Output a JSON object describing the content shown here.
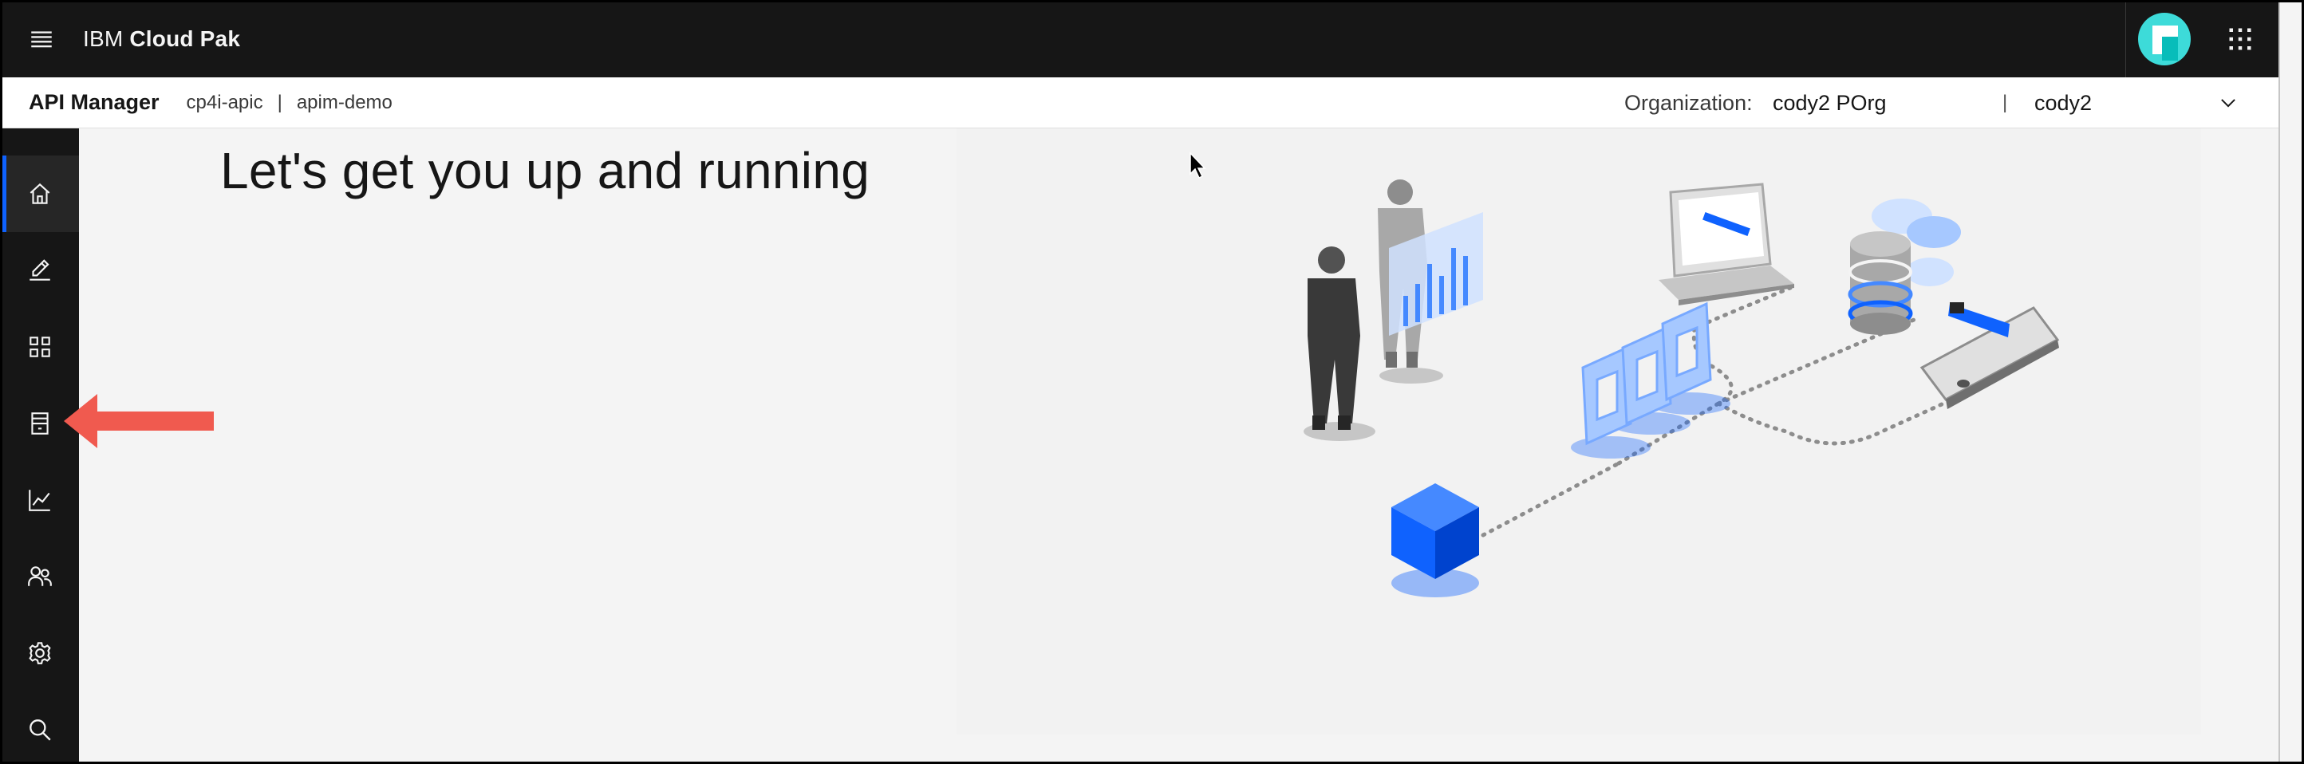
{
  "header": {
    "menu_icon": "hamburger-menu-icon",
    "brand_prefix": "IBM",
    "brand_name": "Cloud Pak",
    "avatar_icon": "user-avatar-icon",
    "apps_icon": "app-switcher-grid-icon"
  },
  "subheader": {
    "title": "API Manager",
    "crumb_1": "cp4i-apic",
    "crumb_sep": "|",
    "crumb_2": "apim-demo",
    "org_label": "Organization:",
    "org_value": "cody2 POrg",
    "pipe": "|",
    "space_value": "cody2",
    "space_icon": "chevron-down-icon"
  },
  "sidenav": {
    "items": [
      {
        "icon": "home-icon",
        "active": true
      },
      {
        "icon": "edit-pencil-icon",
        "active": false
      },
      {
        "icon": "grid-apps-icon",
        "active": false
      },
      {
        "icon": "catalog-icon",
        "active": false
      },
      {
        "icon": "analytics-chart-icon",
        "active": false
      },
      {
        "icon": "users-icon",
        "active": false
      },
      {
        "icon": "settings-gear-icon",
        "active": false
      },
      {
        "icon": "search-icon",
        "active": false
      }
    ]
  },
  "main": {
    "title": "Let's get you up and running"
  },
  "annotation": {
    "arrow_color": "#f05a4f"
  },
  "colors": {
    "header_bg": "#161616",
    "accent": "#0f62fe",
    "avatar": "#3ddbd9"
  }
}
